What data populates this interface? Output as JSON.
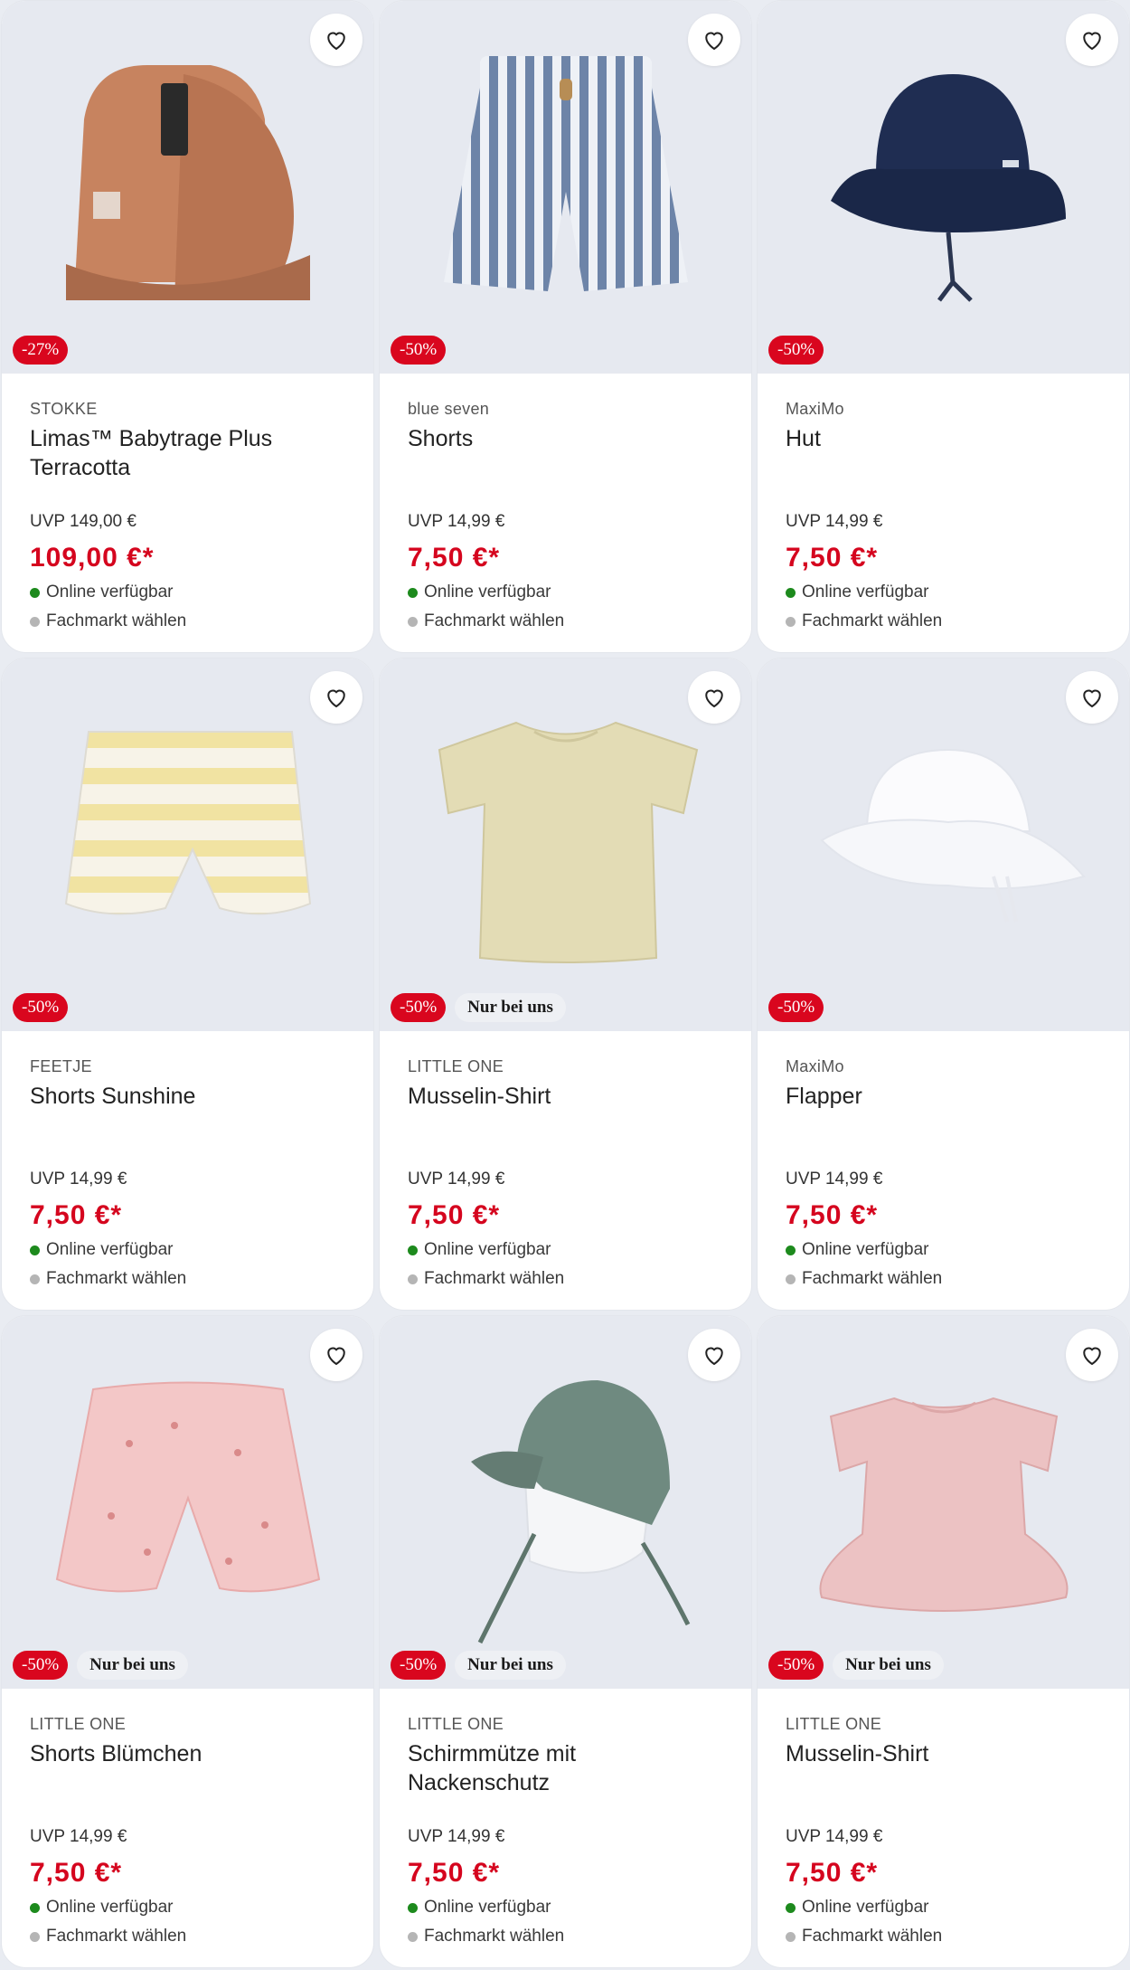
{
  "colors": {
    "accent": "#d9061e",
    "available": "#1d8a1d",
    "store": "#b5b5b5"
  },
  "products": [
    {
      "brand": "STOKKE",
      "title": "Limas™ Babytrage Plus Terracotta",
      "uvp": "UVP 149,00 €",
      "price": "109,00 €*",
      "discount": "-27%",
      "exclusive": "",
      "online": "Online verfügbar",
      "store": "Fachmarkt wählen",
      "icon": "baby-carrier-image"
    },
    {
      "brand": "blue seven",
      "title": "Shorts",
      "uvp": "UVP 14,99 €",
      "price": "7,50 €*",
      "discount": "-50%",
      "exclusive": "",
      "online": "Online verfügbar",
      "store": "Fachmarkt wählen",
      "icon": "striped-shorts-image"
    },
    {
      "brand": "MaxiMo",
      "title": "Hut",
      "uvp": "UVP 14,99 €",
      "price": "7,50 €*",
      "discount": "-50%",
      "exclusive": "",
      "online": "Online verfügbar",
      "store": "Fachmarkt wählen",
      "icon": "bucket-hat-image"
    },
    {
      "brand": "FEETJE",
      "title": "Shorts Sunshine",
      "uvp": "UVP 14,99 €",
      "price": "7,50 €*",
      "discount": "-50%",
      "exclusive": "",
      "online": "Online verfügbar",
      "store": "Fachmarkt wählen",
      "icon": "yellow-shorts-image"
    },
    {
      "brand": "LITTLE ONE",
      "title": "Musselin-Shirt",
      "uvp": "UVP 14,99 €",
      "price": "7,50 €*",
      "discount": "-50%",
      "exclusive": "Nur bei uns",
      "online": "Online verfügbar",
      "store": "Fachmarkt wählen",
      "icon": "beige-shirt-image"
    },
    {
      "brand": "MaxiMo",
      "title": "Flapper",
      "uvp": "UVP 14,99 €",
      "price": "7,50 €*",
      "discount": "-50%",
      "exclusive": "",
      "online": "Online verfügbar",
      "store": "Fachmarkt wählen",
      "icon": "white-sunhat-image"
    },
    {
      "brand": "LITTLE ONE",
      "title": "Shorts Blümchen",
      "uvp": "UVP 14,99 €",
      "price": "7,50 €*",
      "discount": "-50%",
      "exclusive": "Nur bei uns",
      "online": "Online verfügbar",
      "store": "Fachmarkt wählen",
      "icon": "pink-shorts-image"
    },
    {
      "brand": "LITTLE ONE",
      "title": "Schirmmütze mit Nackenschutz",
      "uvp": "UVP 14,99 €",
      "price": "7,50 €*",
      "discount": "-50%",
      "exclusive": "Nur bei uns",
      "online": "Online verfügbar",
      "store": "Fachmarkt wählen",
      "icon": "cap-neck-guard-image"
    },
    {
      "brand": "LITTLE ONE",
      "title": "Musselin-Shirt",
      "uvp": "UVP 14,99 €",
      "price": "7,50 €*",
      "discount": "-50%",
      "exclusive": "Nur bei uns",
      "online": "Online verfügbar",
      "store": "Fachmarkt wählen",
      "icon": "pink-shirt-image"
    }
  ]
}
